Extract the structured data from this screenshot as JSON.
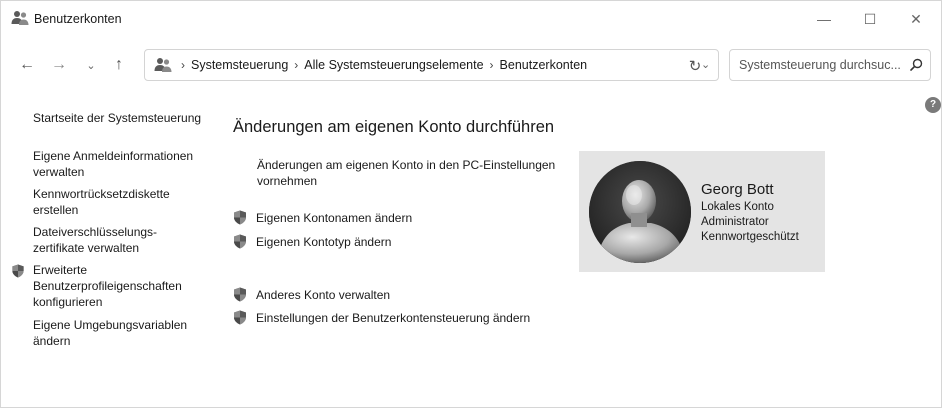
{
  "window": {
    "title": "Benutzerkonten",
    "minimize": "—",
    "maximize": "☐",
    "close": "✕"
  },
  "nav": {
    "back": "←",
    "forward": "→",
    "recent": "⌄",
    "up": "↑",
    "breadcrumbs": [
      "Systemsteuerung",
      "Alle Systemsteuerungselemente",
      "Benutzerkonten"
    ],
    "separator": "›",
    "address_dropdown": "⌄",
    "refresh": "↻",
    "search_placeholder": "Systemsteuerung durchsuc..."
  },
  "help": "?",
  "sidebar": {
    "items": [
      {
        "label": "Startseite der Systemsteuerung"
      },
      {
        "label": "Eigene Anmeldeinformationen verwalten"
      },
      {
        "label": "Kennwortrücksetzdiskette erstellen"
      },
      {
        "label": "Dateiverschlüsselungs-zertifikate verwalten"
      },
      {
        "label": "Erweiterte Benutzerprofileigenschaften konfigurieren"
      },
      {
        "label": "Eigene Umgebungsvariablen ändern"
      }
    ]
  },
  "main": {
    "title": "Änderungen am eigenen Konto durchführen",
    "pc_settings_link": "Änderungen am eigenen Konto in den PC-Einstellungen vornehmen",
    "links": [
      {
        "label": "Eigenen Kontonamen ändern"
      },
      {
        "label": "Eigenen Kontotyp ändern"
      },
      {
        "label": "Anderes Konto verwalten"
      },
      {
        "label": "Einstellungen der Benutzerkontensteuerung ändern"
      }
    ]
  },
  "account": {
    "name": "Georg Bott",
    "type": "Lokales Konto",
    "role": "Administrator",
    "protection": "Kennwortgeschützt"
  },
  "colors": {
    "card_bg": "#e4e4e4",
    "shield_blue": "#4a6fa5",
    "shield_gold": "#d9a520"
  }
}
